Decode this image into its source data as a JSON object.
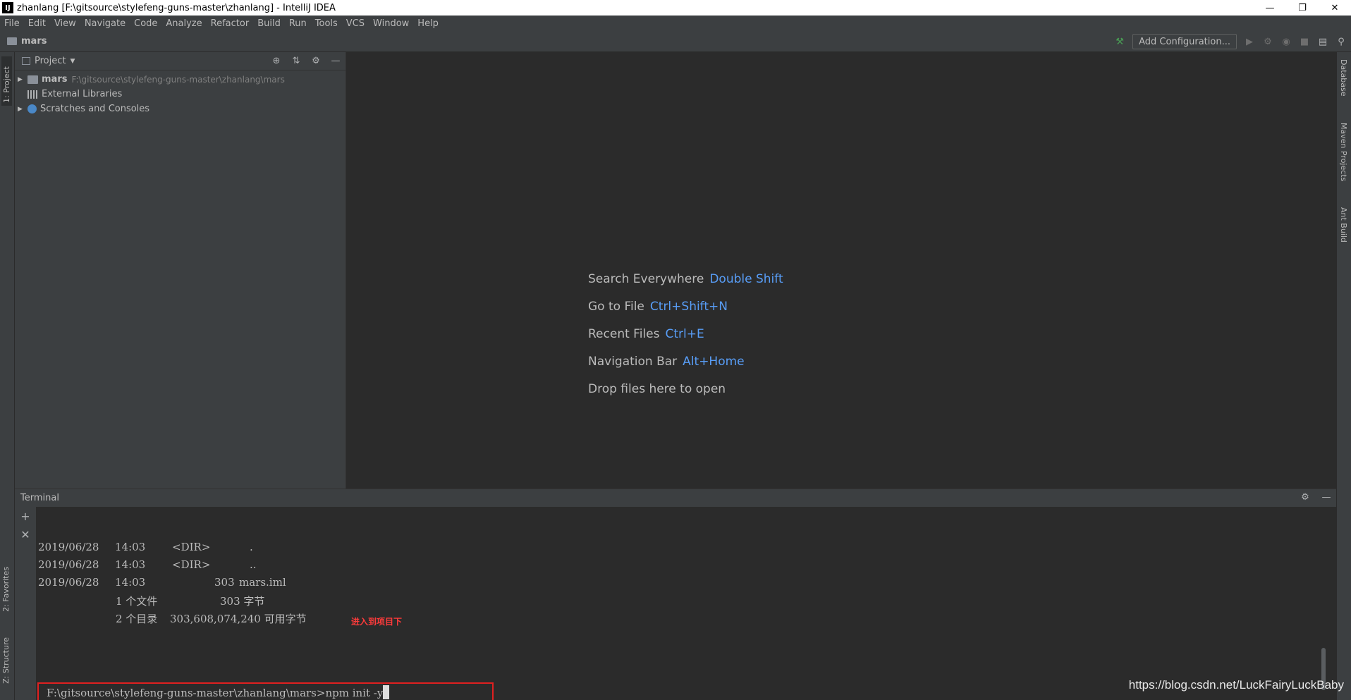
{
  "window": {
    "title": "zhanlang [F:\\gitsource\\stylefeng-guns-master\\zhanlang] - IntelliJ IDEA",
    "app_icon": "IJ",
    "minimize": "—",
    "restore": "❐",
    "close": "✕"
  },
  "menu": [
    "File",
    "Edit",
    "View",
    "Navigate",
    "Code",
    "Analyze",
    "Refactor",
    "Build",
    "Run",
    "Tools",
    "VCS",
    "Window",
    "Help"
  ],
  "navbar": {
    "breadcrumb": "mars",
    "add_configuration": "Add Configuration..."
  },
  "left_tabs": {
    "project": "1: Project",
    "favorites": "2: Favorites",
    "structure": "Z: Structure"
  },
  "right_tabs": {
    "database": "Database",
    "maven": "Maven Projects",
    "ant": "Ant Build"
  },
  "project_panel": {
    "title": "Project",
    "tree": [
      {
        "name": "mars",
        "path": "F:\\gitsource\\stylefeng-guns-master\\zhanlang\\mars"
      },
      {
        "name": "External Libraries"
      },
      {
        "name": "Scratches and Consoles"
      }
    ]
  },
  "editor_hints": [
    {
      "label": "Search Everywhere",
      "key": "Double Shift"
    },
    {
      "label": "Go to File",
      "key": "Ctrl+Shift+N"
    },
    {
      "label": "Recent Files",
      "key": "Ctrl+E"
    },
    {
      "label": "Navigation Bar",
      "key": "Alt+Home"
    },
    {
      "label": "Drop files here to open",
      "key": ""
    }
  ],
  "terminal": {
    "title": "Terminal",
    "lines": [
      {
        "date": "2019/06/28",
        "time": "14:03",
        "dir": "<DIR>",
        "name": "."
      },
      {
        "date": "2019/06/28",
        "time": "14:03",
        "dir": "<DIR>",
        "name": ".."
      },
      {
        "date": "2019/06/28",
        "time": "14:03",
        "size": "303",
        "name": "mars.iml"
      }
    ],
    "summary_files": {
      "count": "1 个文件",
      "bytes": "303 字节"
    },
    "summary_dirs": {
      "count": "2 个目录",
      "free": "303,608,074,240 可用字节"
    },
    "annotation": "进入到项目下",
    "prompt": "F:\\gitsource\\stylefeng-guns-master\\zhanlang\\mars>",
    "command": "npm init -y"
  },
  "watermark": "https://blog.csdn.net/LuckFairyLuckBaby"
}
